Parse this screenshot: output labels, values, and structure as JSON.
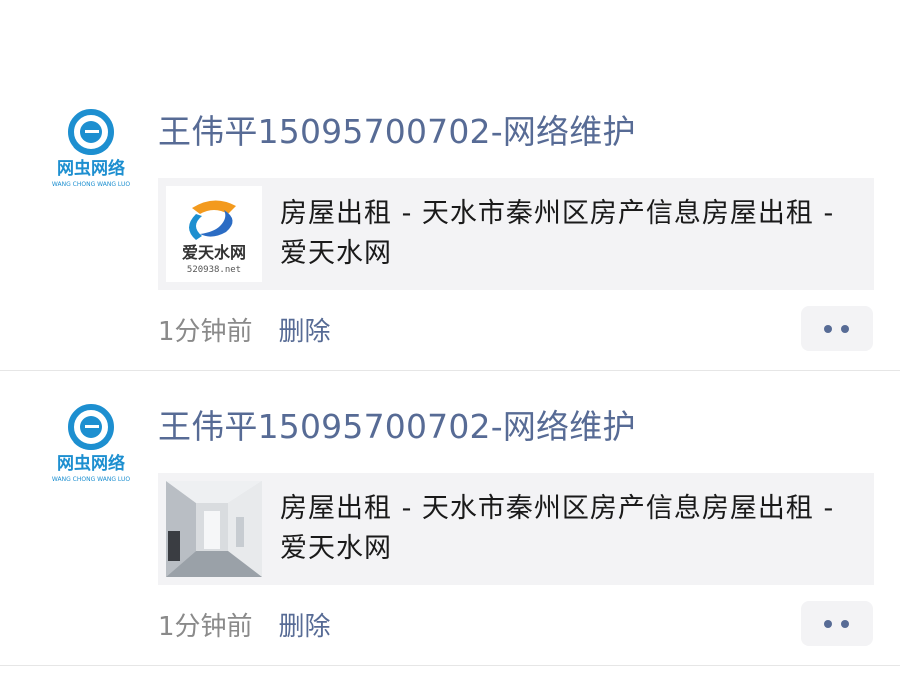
{
  "feed": {
    "posts": [
      {
        "author": "王伟平15095700702-网络维护",
        "avatar_logo_text": "网虫网络",
        "avatar_logo_subtext": "WANG CHONG WANG LUO",
        "link_title": "房屋出租 - 天水市秦州区房产信息房屋出租 - 爱天水网",
        "thumb_logo_text": "爱天水网",
        "thumb_logo_subtext": "520938.net",
        "time": "1分钟前",
        "delete_label": "删除",
        "more_icon": "more-dots-icon"
      },
      {
        "author": "王伟平15095700702-网络维护",
        "avatar_logo_text": "网虫网络",
        "avatar_logo_subtext": "WANG CHONG WANG LUO",
        "link_title": "房屋出租 - 天水市秦州区房产信息房屋出租 - 爱天水网",
        "thumb_photo": "hallway-photo",
        "time": "1分钟前",
        "delete_label": "删除",
        "more_icon": "more-dots-icon"
      }
    ]
  },
  "colors": {
    "link_blue": "#576b95",
    "card_bg": "#f3f3f5",
    "logo_blue": "#1d8fd0",
    "meta_gray": "#8a8a8a"
  }
}
